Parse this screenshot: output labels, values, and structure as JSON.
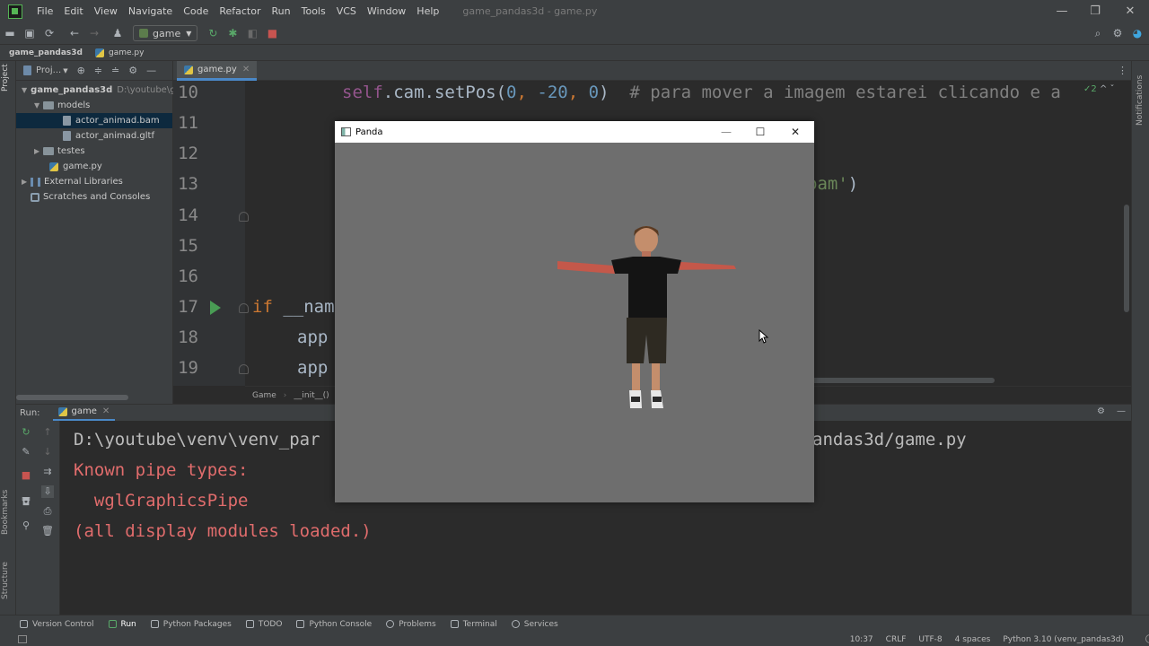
{
  "app": {
    "menu": [
      "File",
      "Edit",
      "View",
      "Navigate",
      "Code",
      "Refactor",
      "Run",
      "Tools",
      "VCS",
      "Window",
      "Help"
    ],
    "window_title": "game_pandas3d - game.py"
  },
  "toolbar": {
    "run_config": "game"
  },
  "navbar": {
    "project": "game_pandas3d",
    "file": "game.py"
  },
  "project_panel": {
    "title": "Proj...",
    "tree": [
      {
        "label": "game_pandas3d",
        "hint": "D:\\youtube\\g",
        "type": "folder",
        "indent": 0,
        "expanded": true
      },
      {
        "label": "models",
        "type": "folder",
        "indent": 1,
        "expanded": true
      },
      {
        "label": "actor_animad.bam",
        "type": "file",
        "indent": 2,
        "selected": true
      },
      {
        "label": "actor_animad.gltf",
        "type": "file",
        "indent": 2
      },
      {
        "label": "testes",
        "type": "folder",
        "indent": 1,
        "expanded": false
      },
      {
        "label": "game.py",
        "type": "python",
        "indent": 1
      },
      {
        "label": "External Libraries",
        "type": "lib",
        "indent": 0,
        "expanded": false
      },
      {
        "label": "Scratches and Consoles",
        "type": "scratch",
        "indent": 0
      }
    ]
  },
  "editor": {
    "tab": "game.py",
    "inspection": "✓2",
    "line_numbers": [
      "10",
      "11",
      "12",
      "13",
      "14",
      "15",
      "16",
      "17",
      "18",
      "19"
    ],
    "line10": {
      "self": "self",
      "call": ".cam.setPos(",
      "args_0": "0",
      "comma1": ", ",
      "args_1": "-20",
      "comma2": ", ",
      "args_2": "0",
      "close": ")",
      "comment": "# para mover a imagem estarei clicando e a"
    },
    "line13_str": "bam'",
    "line13_close": ")",
    "line17_kw": "if",
    "line17_rest": " __nam",
    "line18": "app",
    "line19": "app",
    "breadcrumbs": [
      "Game",
      "__init__()"
    ]
  },
  "run_panel": {
    "label": "Run:",
    "tab": "game",
    "console": [
      {
        "text": "D:\\youtube\\venv\\venv_par",
        "color": "#bbbbbb"
      },
      {
        "text": "Known pipe types:",
        "color": "#e06c6c"
      },
      {
        "text": "  wglGraphicsPipe",
        "color": "#e06c6c"
      },
      {
        "text": "(all display modules loaded.)",
        "color": "#e06c6c"
      }
    ],
    "console_tail": "andas3d/game.py"
  },
  "left_strip": [
    "Project",
    "Bookmarks",
    "Structure"
  ],
  "right_strip": [
    "Notifications"
  ],
  "tool_windows": [
    "Version Control",
    "Run",
    "Python Packages",
    "TODO",
    "Python Console",
    "Problems",
    "Terminal",
    "Services"
  ],
  "status": {
    "position": "10:37",
    "line_sep": "CRLF",
    "encoding": "UTF-8",
    "indent": "4 spaces",
    "interpreter": "Python 3.10 (venv_pandas3d)"
  },
  "panda_window": {
    "title": "Panda",
    "bg": "#6e6e6e"
  }
}
